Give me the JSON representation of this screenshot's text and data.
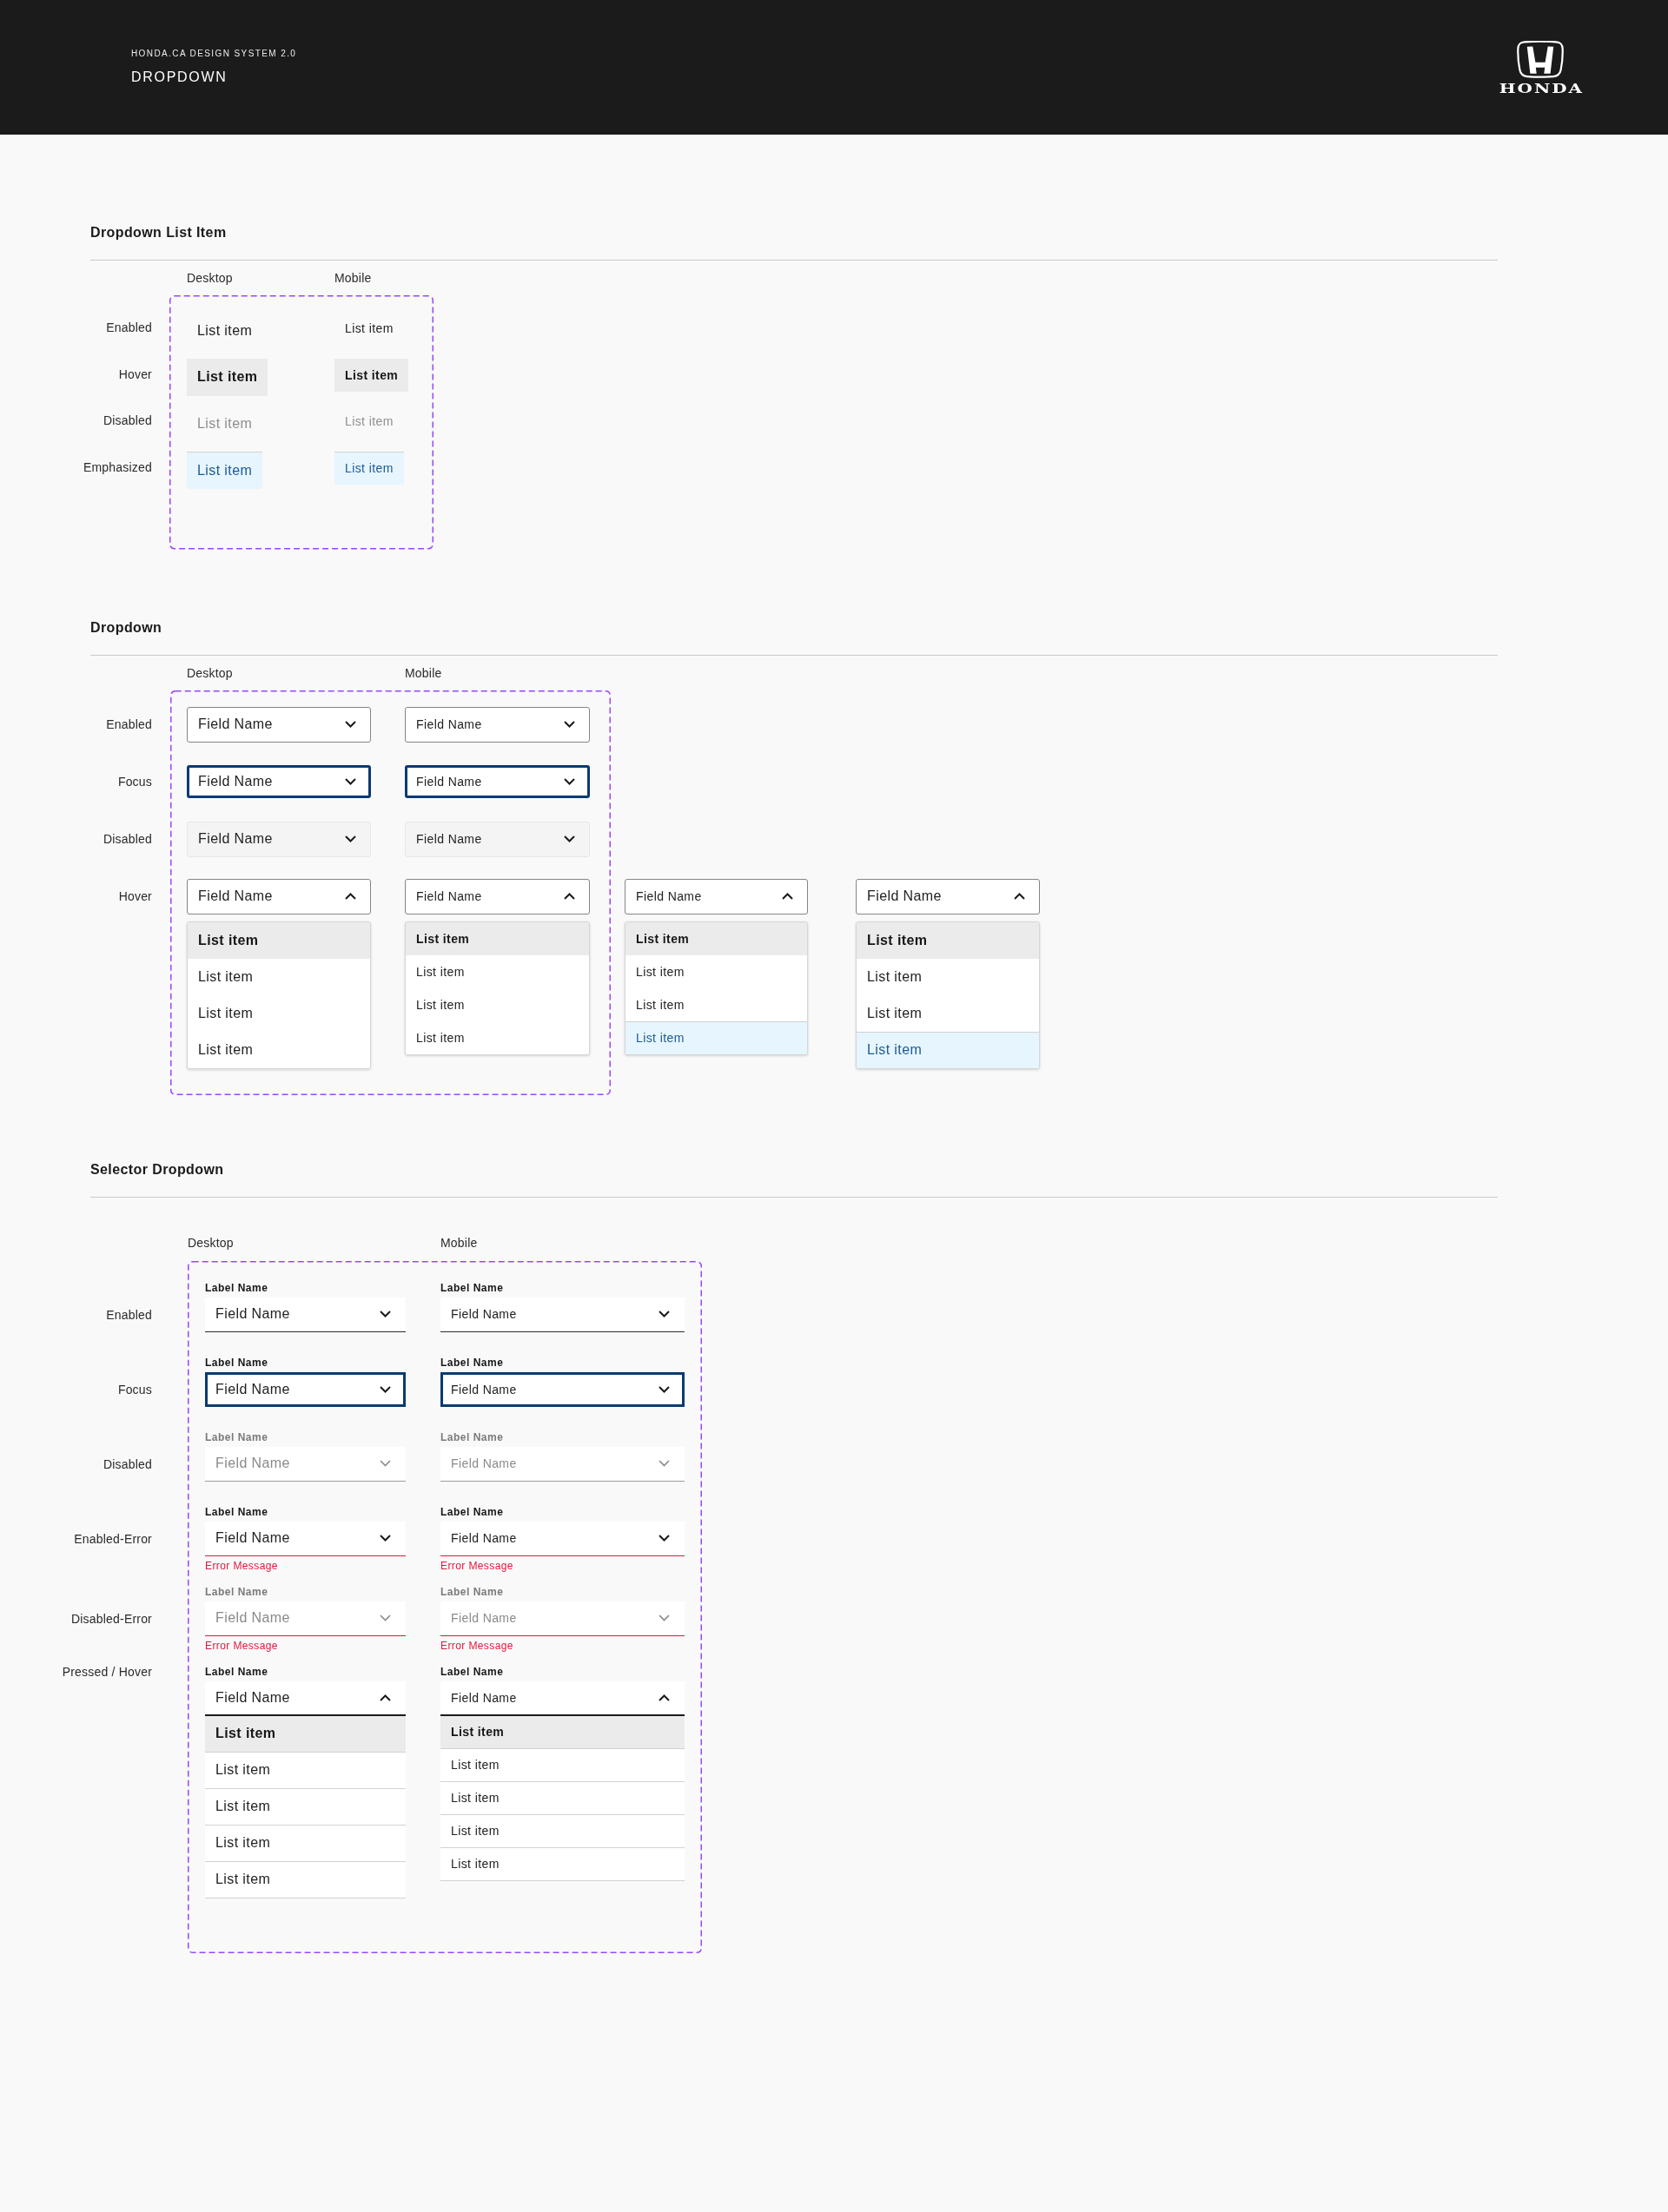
{
  "header": {
    "eyebrow": "HONDA.CA DESIGN SYSTEM 2.0",
    "title": "DROPDOWN",
    "logo_text": "HONDA"
  },
  "sections": [
    {
      "kind": "list-item",
      "title": "Dropdown List Item",
      "columns": [
        "Desktop",
        "Mobile"
      ],
      "rows": [
        {
          "label": "Enabled",
          "cells": [
            {
              "kind": "desktop",
              "text": "List item",
              "hovered": false,
              "disabled": false,
              "emphasized": false
            },
            {
              "kind": "mobile",
              "text": "List item",
              "hovered": false,
              "disabled": false,
              "emphasized": false
            }
          ]
        },
        {
          "label": "Hover",
          "cells": [
            {
              "kind": "desktop",
              "text": "List item",
              "hovered": true,
              "disabled": false,
              "emphasized": false
            },
            {
              "kind": "mobile",
              "text": "List item",
              "hovered": true,
              "disabled": false,
              "emphasized": false
            }
          ]
        },
        {
          "label": "Disabled",
          "cells": [
            {
              "kind": "desktop",
              "text": "List item",
              "hovered": false,
              "disabled": true,
              "emphasized": false
            },
            {
              "kind": "mobile",
              "text": "List item",
              "hovered": false,
              "disabled": true,
              "emphasized": false
            }
          ]
        },
        {
          "label": "Emphasized",
          "cells": [
            {
              "kind": "desktop",
              "text": "List item",
              "hovered": false,
              "disabled": false,
              "emphasized": true
            },
            {
              "kind": "mobile",
              "text": "List item",
              "hovered": false,
              "disabled": false,
              "emphasized": true
            }
          ]
        }
      ]
    },
    {
      "kind": "dropdown",
      "title": "Dropdown",
      "columns": [
        "Desktop",
        "Mobile"
      ],
      "rows": [
        {
          "label": "Enabled",
          "cells": [
            {
              "kind": "desktop",
              "value": "Field Name",
              "focused": false,
              "disabled": false,
              "expanded": false
            },
            {
              "kind": "mobile",
              "value": "Field Name",
              "focused": false,
              "disabled": false,
              "expanded": false
            }
          ]
        },
        {
          "label": "Focus",
          "cells": [
            {
              "kind": "desktop",
              "value": "Field Name",
              "focused": true,
              "disabled": false,
              "expanded": false
            },
            {
              "kind": "mobile",
              "value": "Field Name",
              "focused": true,
              "disabled": false,
              "expanded": false
            }
          ]
        },
        {
          "label": "Disabled",
          "cells": [
            {
              "kind": "desktop",
              "value": "Field Name",
              "focused": false,
              "disabled": true,
              "expanded": false
            },
            {
              "kind": "mobile",
              "value": "Field Name",
              "focused": false,
              "disabled": true,
              "expanded": false
            }
          ]
        },
        {
          "label": "Hover",
          "cells": [
            {
              "kind": "desktop",
              "value": "Field Name",
              "focused": false,
              "disabled": false,
              "expanded": true,
              "options": [
                {
                  "text": "List item",
                  "hovered": true,
                  "emphasized": false
                },
                {
                  "text": "List item",
                  "hovered": false,
                  "emphasized": false
                },
                {
                  "text": "List item",
                  "hovered": false,
                  "emphasized": false
                },
                {
                  "text": "List item",
                  "hovered": false,
                  "emphasized": false
                }
              ]
            },
            {
              "kind": "mobile",
              "value": "Field Name",
              "focused": false,
              "disabled": false,
              "expanded": true,
              "options": [
                {
                  "text": "List item",
                  "hovered": true,
                  "emphasized": false
                },
                {
                  "text": "List item",
                  "hovered": false,
                  "emphasized": false
                },
                {
                  "text": "List item",
                  "hovered": false,
                  "emphasized": false
                },
                {
                  "text": "List item",
                  "hovered": false,
                  "emphasized": false
                }
              ]
            },
            {
              "kind": "mobile",
              "value": "Field Name",
              "focused": false,
              "disabled": false,
              "expanded": true,
              "options": [
                {
                  "text": "List item",
                  "hovered": true,
                  "emphasized": false
                },
                {
                  "text": "List item",
                  "hovered": false,
                  "emphasized": false
                },
                {
                  "text": "List item",
                  "hovered": false,
                  "emphasized": false
                },
                {
                  "text": "List item",
                  "hovered": false,
                  "emphasized": true
                }
              ]
            },
            {
              "kind": "desktop",
              "value": "Field Name",
              "focused": false,
              "disabled": false,
              "expanded": true,
              "options": [
                {
                  "text": "List item",
                  "hovered": true,
                  "emphasized": false
                },
                {
                  "text": "List item",
                  "hovered": false,
                  "emphasized": false
                },
                {
                  "text": "List item",
                  "hovered": false,
                  "emphasized": false
                },
                {
                  "text": "List item",
                  "hovered": false,
                  "emphasized": true
                }
              ]
            }
          ]
        }
      ]
    },
    {
      "kind": "selector",
      "title": "Selector Dropdown",
      "columns": [
        "Desktop",
        "Mobile"
      ],
      "rows": [
        {
          "label": "Enabled",
          "cells": [
            {
              "kind": "desktop",
              "label": "Label Name",
              "value": "Field Name",
              "focused": false,
              "disabled": false,
              "expanded": false
            },
            {
              "kind": "mobile",
              "label": "Label Name",
              "value": "Field Name",
              "focused": false,
              "disabled": false,
              "expanded": false
            }
          ]
        },
        {
          "label": "Focus",
          "cells": [
            {
              "kind": "desktop",
              "label": "Label Name",
              "value": "Field Name",
              "focused": true,
              "disabled": false,
              "expanded": false
            },
            {
              "kind": "mobile",
              "label": "Label Name",
              "value": "Field Name",
              "focused": true,
              "disabled": false,
              "expanded": false
            }
          ]
        },
        {
          "label": "Disabled",
          "cells": [
            {
              "kind": "desktop",
              "label": "Label Name",
              "value": "Field Name",
              "focused": false,
              "disabled": true,
              "expanded": false
            },
            {
              "kind": "mobile",
              "label": "Label Name",
              "value": "Field Name",
              "focused": false,
              "disabled": true,
              "expanded": false
            }
          ]
        },
        {
          "label": "Enabled-Error",
          "cells": [
            {
              "kind": "desktop",
              "label": "Label Name",
              "value": "Field Name",
              "focused": false,
              "disabled": false,
              "expanded": false,
              "error": "Error Message"
            },
            {
              "kind": "mobile",
              "label": "Label Name",
              "value": "Field Name",
              "focused": false,
              "disabled": false,
              "expanded": false,
              "error": "Error Message"
            }
          ]
        },
        {
          "label": "Disabled-Error",
          "cells": [
            {
              "kind": "desktop",
              "label": "Label Name",
              "value": "Field Name",
              "focused": false,
              "disabled": true,
              "expanded": false,
              "error": "Error Message"
            },
            {
              "kind": "mobile",
              "label": "Label Name",
              "value": "Field Name",
              "focused": false,
              "disabled": true,
              "expanded": false,
              "error": "Error Message"
            }
          ]
        },
        {
          "label": "Pressed / Hover",
          "cells": [
            {
              "kind": "desktop",
              "label": "Label Name",
              "value": "Field Name",
              "focused": false,
              "disabled": false,
              "expanded": true,
              "options": [
                {
                  "text": "List item",
                  "hovered": true,
                  "emphasized": false
                },
                {
                  "text": "List item",
                  "hovered": false,
                  "emphasized": false
                },
                {
                  "text": "List item",
                  "hovered": false,
                  "emphasized": false
                },
                {
                  "text": "List item",
                  "hovered": false,
                  "emphasized": false
                },
                {
                  "text": "List item",
                  "hovered": false,
                  "emphasized": false
                }
              ]
            },
            {
              "kind": "mobile",
              "label": "Label Name",
              "value": "Field Name",
              "focused": false,
              "disabled": false,
              "expanded": true,
              "options": [
                {
                  "text": "List item",
                  "hovered": true,
                  "emphasized": false
                },
                {
                  "text": "List item",
                  "hovered": false,
                  "emphasized": false
                },
                {
                  "text": "List item",
                  "hovered": false,
                  "emphasized": false
                },
                {
                  "text": "List item",
                  "hovered": false,
                  "emphasized": false
                },
                {
                  "text": "List item",
                  "hovered": false,
                  "emphasized": false
                }
              ]
            }
          ]
        }
      ]
    }
  ]
}
